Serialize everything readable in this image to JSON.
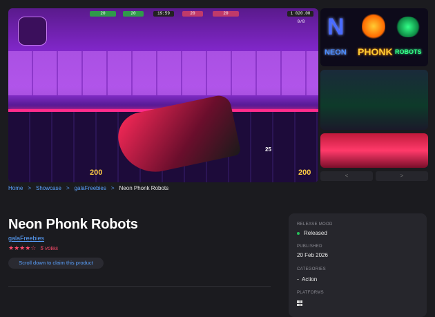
{
  "gallery": {
    "hud": {
      "left_value": "20",
      "center_left_value": "20",
      "timer": "19:59",
      "center_right_value": "20",
      "right_value": "20",
      "score": "1 020.00",
      "count": "0/8",
      "ammo_left": "200",
      "ammo_right": "200",
      "kills": "25"
    },
    "thumb_top": {
      "letters": [
        "N",
        "NEON",
        "PHONK",
        "ROBOTS"
      ]
    },
    "nav": {
      "prev_label": "<",
      "next_label": ">"
    }
  },
  "breadcrumb": {
    "items": [
      "Home",
      "Showcase",
      "galaFreebies"
    ],
    "current": "Neon Phonk Robots",
    "separator": ">"
  },
  "product": {
    "title": "Neon Phonk Robots",
    "publisher": "galaFreebies",
    "stars": "★★★★☆",
    "votes": "5 votes",
    "claim_label": "Scroll down to claim this product"
  },
  "info": {
    "release_mood_label": "RELEASE MOOD",
    "release_mood_value": "Released",
    "published_label": "PUBLISHED",
    "published_value": "20 Feb 2026",
    "categories_label": "CATEGORIES",
    "categories_value": "Action",
    "platforms_label": "PLATFORMS"
  },
  "colors": {
    "background": "#1b1b1f",
    "link": "#5aa2ff",
    "rating": "#ff4a6a",
    "status_green": "#26c05a",
    "panel": "#26262c"
  }
}
